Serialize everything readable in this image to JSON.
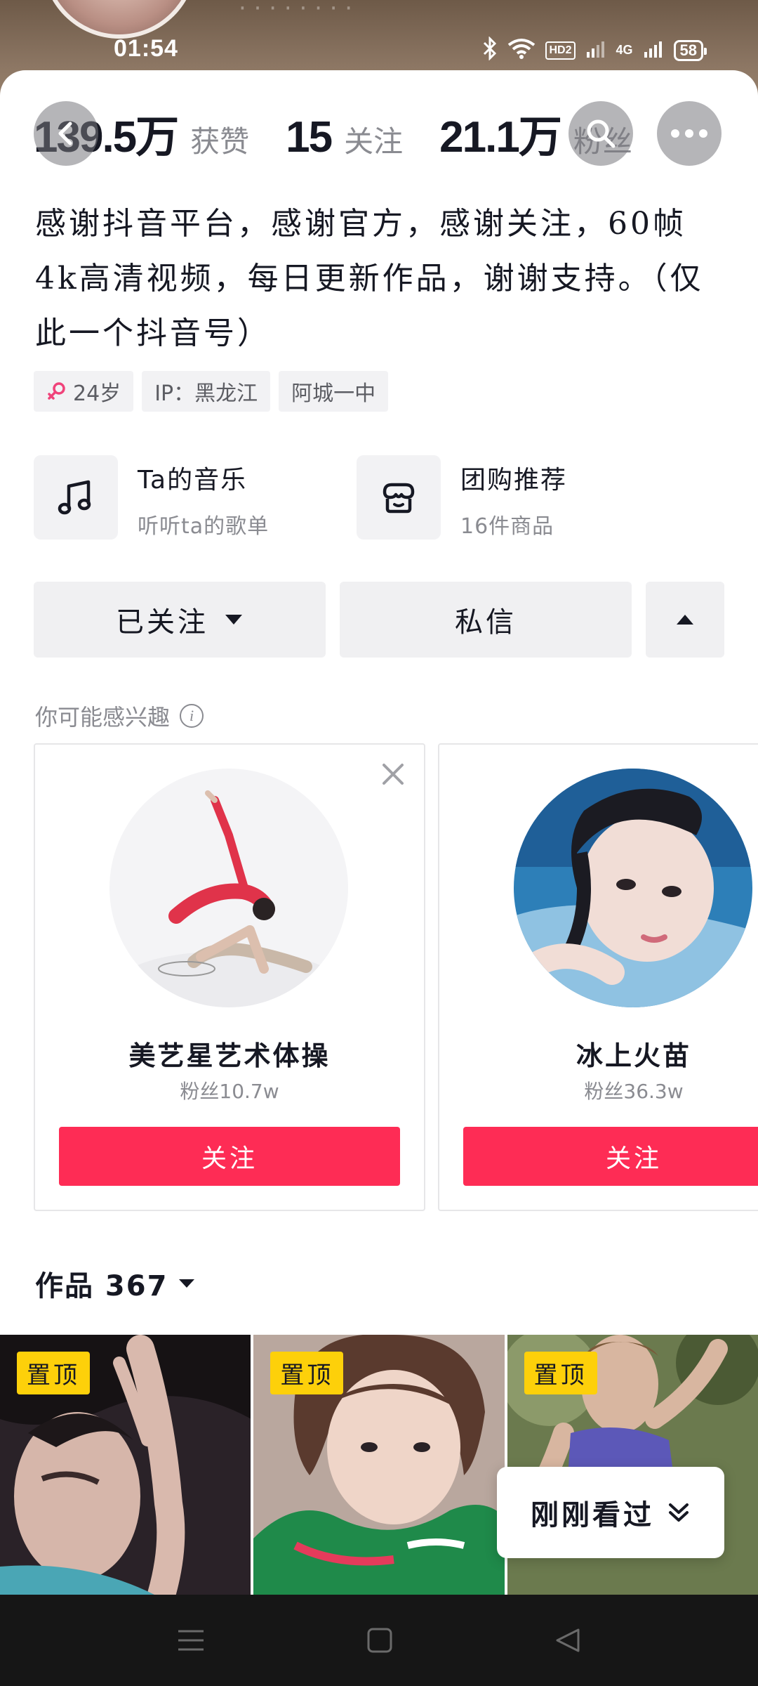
{
  "status_bar": {
    "time": "01:54",
    "hd": "HD2",
    "network": "4G",
    "battery": "58"
  },
  "profile": {
    "stats": [
      {
        "value": "139.5万",
        "label": "获赞"
      },
      {
        "value": "15",
        "label": "关注"
      },
      {
        "value": "21.1万",
        "label": "粉丝"
      }
    ],
    "bio": "感谢抖音平台，感谢官方，感谢关注，60帧4k高清视频，每日更新作品，谢谢支持。（仅此一个抖音号）",
    "tags": [
      {
        "icon": "female-icon",
        "text": "24岁"
      },
      {
        "text": "IP：黑龙江"
      },
      {
        "text": "阿城一中"
      }
    ]
  },
  "features": [
    {
      "icon": "music-note-icon",
      "title": "Ta的音乐",
      "subtitle": "听听ta的歌单"
    },
    {
      "icon": "shop-icon",
      "title": "团购推荐",
      "subtitle": "16件商品"
    }
  ],
  "actions": {
    "followed_label": "已关注",
    "message_label": "私信"
  },
  "suggestions": {
    "heading": "你可能感兴趣",
    "cards": [
      {
        "name": "美艺星艺术体操",
        "fans": "粉丝10.7w",
        "follow_label": "关注"
      },
      {
        "name": "冰上火苗",
        "fans": "粉丝36.3w",
        "follow_label": "关注"
      }
    ]
  },
  "works": {
    "heading": "作品 367",
    "pin_label": "置顶",
    "recent_label": "刚刚看过"
  },
  "colors": {
    "accent": "#fe2c55",
    "pin": "#fdd00a"
  }
}
